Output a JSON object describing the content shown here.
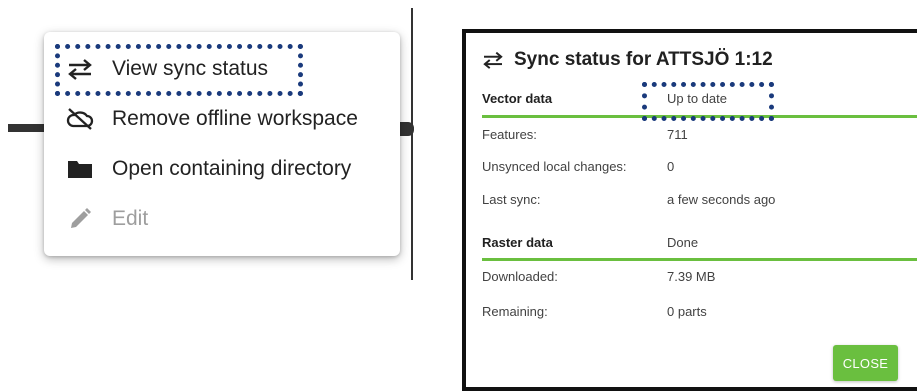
{
  "context_menu": {
    "items": [
      {
        "label": "View sync status",
        "icon": "sync-arrows-icon",
        "disabled": false
      },
      {
        "label": "Remove offline workspace",
        "icon": "cloud-off-icon",
        "disabled": false
      },
      {
        "label": "Open containing directory",
        "icon": "folder-icon",
        "disabled": false
      },
      {
        "label": "Edit",
        "icon": "pencil-icon",
        "disabled": true
      }
    ]
  },
  "dialog": {
    "title": "Sync status for ATTSJÖ 1:12",
    "title_icon": "sync-arrows-icon",
    "vector": {
      "heading": "Vector data",
      "status": "Up to date",
      "rows": [
        {
          "key": "Features:",
          "value": "711"
        },
        {
          "key": "Unsynced local changes:",
          "value": "0"
        },
        {
          "key": "Last sync:",
          "value": "a few seconds ago"
        }
      ]
    },
    "raster": {
      "heading": "Raster data",
      "status": "Done",
      "rows": [
        {
          "key": "Downloaded:",
          "value": "7.39 MB"
        },
        {
          "key": "Remaining:",
          "value": "0 parts"
        }
      ]
    },
    "close_label": "CLOSE"
  },
  "colors": {
    "accent_green": "#6abf3f",
    "highlight_dots": "#1a3a7c"
  }
}
